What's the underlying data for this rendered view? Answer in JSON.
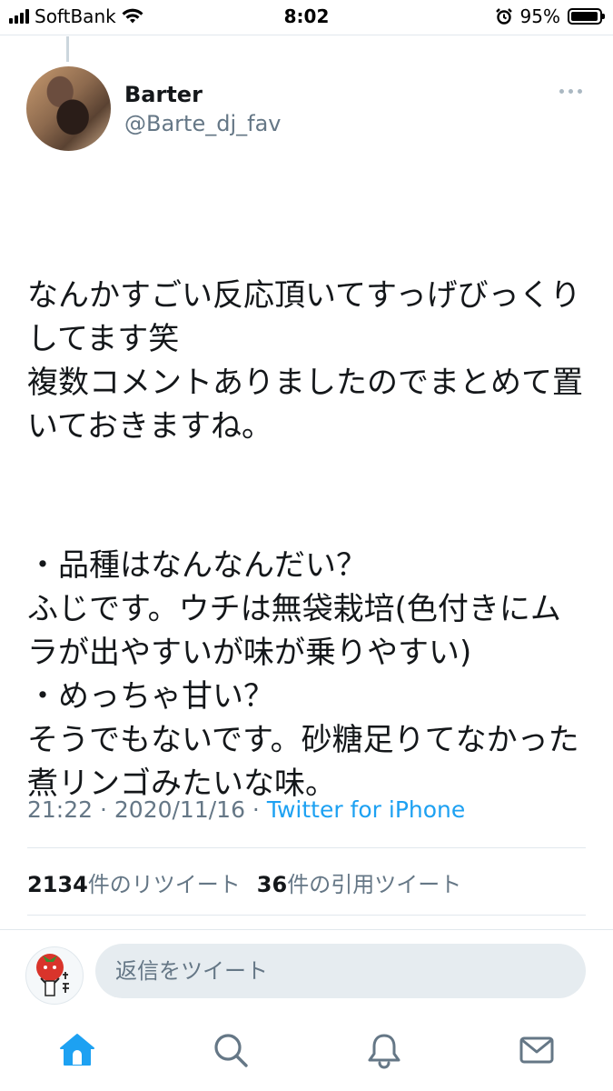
{
  "status_bar": {
    "carrier": "SoftBank",
    "time": "8:02",
    "battery": "95%",
    "battery_level": 0.95
  },
  "tweet": {
    "author_name": "Barter",
    "author_handle": "@Barte_dj_fav",
    "text": [
      "なんかすごい反応頂いてすっげびっくりしてます笑\n複数コメントありましたのでまとめて置いておきますね。",
      "・品種はなんなんだい？\nふじです。ウチは無袋栽培(色付きにムラが出やすいが味が乗りやすい)\n・めっちゃ甘い？\nそうでもないです。砂糖足りてなかった煮リンゴみたいな味。"
    ],
    "time": "21:22",
    "date": "2020/11/16",
    "separator": " · ",
    "client": "Twitter for iPhone"
  },
  "stats": {
    "retweets_count": "2134",
    "retweets_label": "件のリツイート",
    "quotes_count": "36",
    "quotes_label": "件の引用ツイート"
  },
  "reply": {
    "placeholder": "返信をツイート"
  },
  "tabs": [
    {
      "name": "home",
      "icon": "home-icon",
      "active": true
    },
    {
      "name": "search",
      "icon": "search-icon",
      "active": false
    },
    {
      "name": "notifications",
      "icon": "bell-icon",
      "active": false
    },
    {
      "name": "messages",
      "icon": "mail-icon",
      "active": false
    }
  ],
  "colors": {
    "accent": "#1da1f2",
    "secondary_text": "#657786",
    "inactive_icon": "#657786"
  }
}
